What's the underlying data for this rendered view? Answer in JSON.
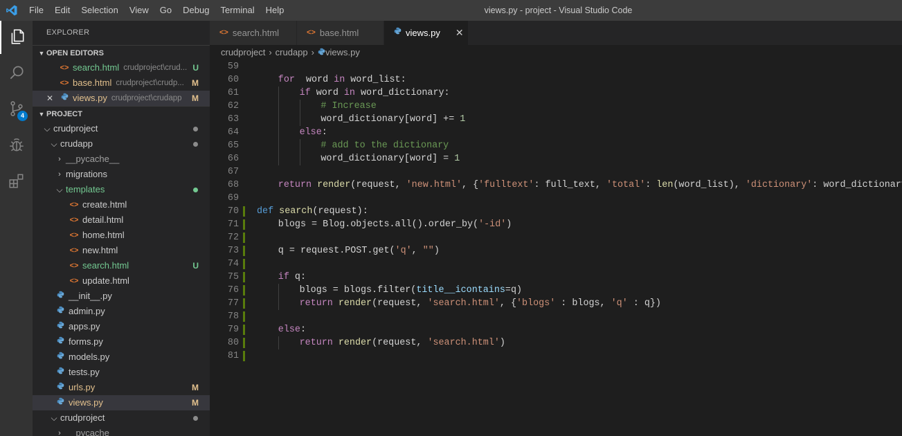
{
  "menu": [
    "File",
    "Edit",
    "Selection",
    "View",
    "Go",
    "Debug",
    "Terminal",
    "Help"
  ],
  "window_title": "views.py - project - Visual Studio Code",
  "activity": [
    {
      "name": "explorer",
      "active": true
    },
    {
      "name": "search"
    },
    {
      "name": "source-control",
      "badge": "4"
    },
    {
      "name": "debug"
    },
    {
      "name": "extensions"
    }
  ],
  "explorer": {
    "title": "EXPLORER",
    "open_editors": {
      "label": "OPEN EDITORS",
      "items": [
        {
          "file": "search.html",
          "type": "html",
          "desc": "crudproject\\crud...",
          "status": "U"
        },
        {
          "file": "base.html",
          "type": "html",
          "desc": "crudproject\\crudp...",
          "status": "M"
        },
        {
          "file": "views.py",
          "type": "py",
          "desc": "crudproject\\crudapp",
          "status": "M",
          "active": true
        }
      ]
    },
    "project": {
      "label": "PROJECT",
      "tree": [
        {
          "label": "crudproject",
          "depth": 0,
          "folder": true,
          "open": true,
          "dot": "#8b8b8b"
        },
        {
          "label": "crudapp",
          "depth": 1,
          "folder": true,
          "open": true,
          "dot": "#8b8b8b"
        },
        {
          "label": "__pycache__",
          "depth": 2,
          "folder": true,
          "open": false,
          "dim": true
        },
        {
          "label": "migrations",
          "depth": 2,
          "folder": true,
          "open": false
        },
        {
          "label": "templates",
          "depth": 2,
          "folder": true,
          "open": true,
          "color": "#73c991",
          "dot": "#73c991"
        },
        {
          "label": "create.html",
          "depth": 3,
          "type": "html"
        },
        {
          "label": "detail.html",
          "depth": 3,
          "type": "html"
        },
        {
          "label": "home.html",
          "depth": 3,
          "type": "html"
        },
        {
          "label": "new.html",
          "depth": 3,
          "type": "html"
        },
        {
          "label": "search.html",
          "depth": 3,
          "type": "html",
          "status": "U",
          "color": "#73c991"
        },
        {
          "label": "update.html",
          "depth": 3,
          "type": "html"
        },
        {
          "label": "__init__.py",
          "depth": 2,
          "type": "py"
        },
        {
          "label": "admin.py",
          "depth": 2,
          "type": "py"
        },
        {
          "label": "apps.py",
          "depth": 2,
          "type": "py"
        },
        {
          "label": "forms.py",
          "depth": 2,
          "type": "py"
        },
        {
          "label": "models.py",
          "depth": 2,
          "type": "py"
        },
        {
          "label": "tests.py",
          "depth": 2,
          "type": "py"
        },
        {
          "label": "urls.py",
          "depth": 2,
          "type": "py",
          "status": "M",
          "color": "#e2c08d"
        },
        {
          "label": "views.py",
          "depth": 2,
          "type": "py",
          "status": "M",
          "color": "#e2c08d",
          "selected": true
        },
        {
          "label": "crudproject",
          "depth": 1,
          "folder": true,
          "open": true,
          "dot": "#8b8b8b"
        },
        {
          "label": "__pycache__",
          "depth": 2,
          "folder": true,
          "open": false,
          "dim": true
        }
      ]
    }
  },
  "tabs": [
    {
      "label": "search.html",
      "type": "html"
    },
    {
      "label": "base.html",
      "type": "html"
    },
    {
      "label": "views.py",
      "type": "py",
      "active": true,
      "close": "✕"
    }
  ],
  "breadcrumb": [
    "crudproject",
    "crudapp",
    "views.py"
  ],
  "code": {
    "first_line": 59,
    "lines": [
      {
        "g": "",
        "t": []
      },
      {
        "g": "",
        "i": 1,
        "t": [
          [
            "k2",
            "for"
          ],
          [
            "",
            "  word "
          ],
          [
            "k2",
            "in"
          ],
          [
            "",
            " word_list:"
          ]
        ]
      },
      {
        "g": "",
        "i": 2,
        "t": [
          [
            "k2",
            "if"
          ],
          [
            "",
            " word "
          ],
          [
            "k2",
            "in"
          ],
          [
            "",
            " word_dictionary:"
          ]
        ]
      },
      {
        "g": "",
        "i": 3,
        "t": [
          [
            "cm",
            "# Increase"
          ]
        ]
      },
      {
        "g": "",
        "i": 3,
        "t": [
          [
            "",
            "word_dictionary[word] += "
          ],
          [
            "nm",
            "1"
          ]
        ]
      },
      {
        "g": "",
        "i": 2,
        "t": [
          [
            "k2",
            "else"
          ],
          [
            "",
            ":"
          ]
        ]
      },
      {
        "g": "",
        "i": 3,
        "t": [
          [
            "cm",
            "# add to the dictionary"
          ]
        ]
      },
      {
        "g": "",
        "i": 3,
        "t": [
          [
            "",
            "word_dictionary[word] = "
          ],
          [
            "nm",
            "1"
          ]
        ]
      },
      {
        "g": "",
        "t": []
      },
      {
        "g": "",
        "i": 1,
        "t": [
          [
            "k2",
            "return"
          ],
          [
            "",
            " "
          ],
          [
            "fn",
            "render"
          ],
          [
            "",
            "(request, "
          ],
          [
            "str",
            "'new.html'"
          ],
          [
            "",
            ", {"
          ],
          [
            "str",
            "'fulltext'"
          ],
          [
            "",
            ": full_text, "
          ],
          [
            "str",
            "'total'"
          ],
          [
            "",
            ": "
          ],
          [
            "fn",
            "len"
          ],
          [
            "",
            "(word_list), "
          ],
          [
            "str",
            "'dictionary'"
          ],
          [
            "",
            ": word_dictionary.ite"
          ]
        ]
      },
      {
        "g": "",
        "t": []
      },
      {
        "g": "#587c0c",
        "i": 0,
        "t": [
          [
            "k1",
            "def"
          ],
          [
            "",
            " "
          ],
          [
            "fn",
            "search"
          ],
          [
            "",
            "(request):"
          ]
        ]
      },
      {
        "g": "#587c0c",
        "i": 1,
        "t": [
          [
            "",
            "blogs = Blog.objects.all().order_by("
          ],
          [
            "str",
            "'-id'"
          ],
          [
            "",
            ")"
          ]
        ]
      },
      {
        "g": "#587c0c",
        "t": []
      },
      {
        "g": "#587c0c",
        "i": 1,
        "t": [
          [
            "",
            "q = request.POST.get("
          ],
          [
            "str",
            "'q'"
          ],
          [
            "",
            ", "
          ],
          [
            "str",
            "\"\""
          ],
          [
            "",
            ")"
          ]
        ]
      },
      {
        "g": "#587c0c",
        "t": []
      },
      {
        "g": "#587c0c",
        "i": 1,
        "t": [
          [
            "k2",
            "if"
          ],
          [
            "",
            " q:"
          ]
        ]
      },
      {
        "g": "#587c0c",
        "i": 2,
        "t": [
          [
            "",
            "blogs = blogs.filter("
          ],
          [
            "vr",
            "title__icontains"
          ],
          [
            "",
            "=q)"
          ]
        ]
      },
      {
        "g": "#587c0c",
        "i": 2,
        "t": [
          [
            "k2",
            "return"
          ],
          [
            "",
            " "
          ],
          [
            "fn",
            "render"
          ],
          [
            "",
            "(request, "
          ],
          [
            "str",
            "'search.html'"
          ],
          [
            "",
            ", {"
          ],
          [
            "str",
            "'blogs'"
          ],
          [
            "",
            " : blogs, "
          ],
          [
            "str",
            "'q'"
          ],
          [
            "",
            " : q})"
          ]
        ]
      },
      {
        "g": "#587c0c",
        "t": []
      },
      {
        "g": "#587c0c",
        "i": 1,
        "t": [
          [
            "k2",
            "else"
          ],
          [
            "",
            ":"
          ]
        ]
      },
      {
        "g": "#587c0c",
        "i": 2,
        "t": [
          [
            "k2",
            "return"
          ],
          [
            "",
            " "
          ],
          [
            "fn",
            "render"
          ],
          [
            "",
            "(request, "
          ],
          [
            "str",
            "'search.html'"
          ],
          [
            "",
            ")"
          ]
        ]
      },
      {
        "g": "#587c0c",
        "t": []
      }
    ]
  }
}
